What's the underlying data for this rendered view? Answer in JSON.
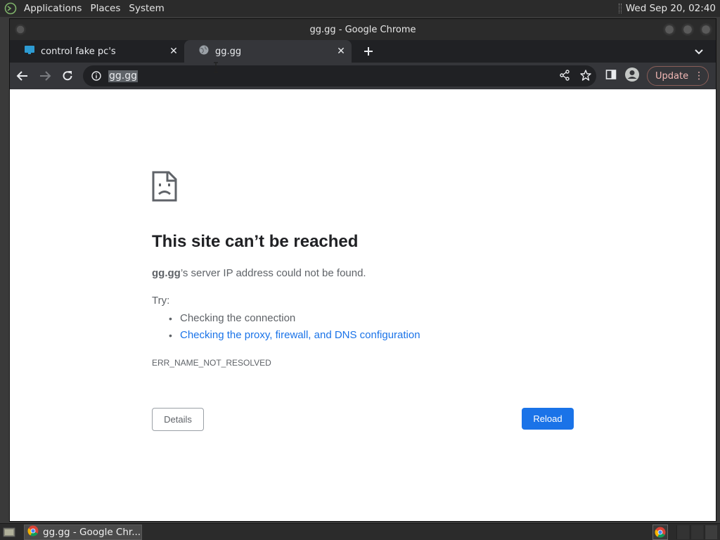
{
  "system_panel": {
    "menu": [
      "Applications",
      "Places",
      "System"
    ],
    "clock": "Wed Sep 20, 02:40"
  },
  "window": {
    "title": "gg.gg - Google Chrome"
  },
  "tabs": [
    {
      "title": "control fake pc's",
      "icon": "monitor-icon"
    },
    {
      "title": "gg.gg",
      "icon": "globe-icon"
    }
  ],
  "toolbar": {
    "url": "gg.gg",
    "update_label": "Update"
  },
  "error_page": {
    "title": "This site can’t be reached",
    "host": "gg.gg",
    "summary_suffix": "’s server IP address could not be found.",
    "try_label": "Try:",
    "suggestions": [
      "Checking the connection",
      "Checking the proxy, firewall, and DNS configuration"
    ],
    "error_code": "ERR_NAME_NOT_RESOLVED",
    "details_label": "Details",
    "reload_label": "Reload"
  },
  "taskbar": {
    "task_label": "gg.gg - Google Chr..."
  },
  "colors": {
    "link": "#1a73e8",
    "reload_button": "#1a73e8",
    "update_text": "#f2b8b5"
  }
}
